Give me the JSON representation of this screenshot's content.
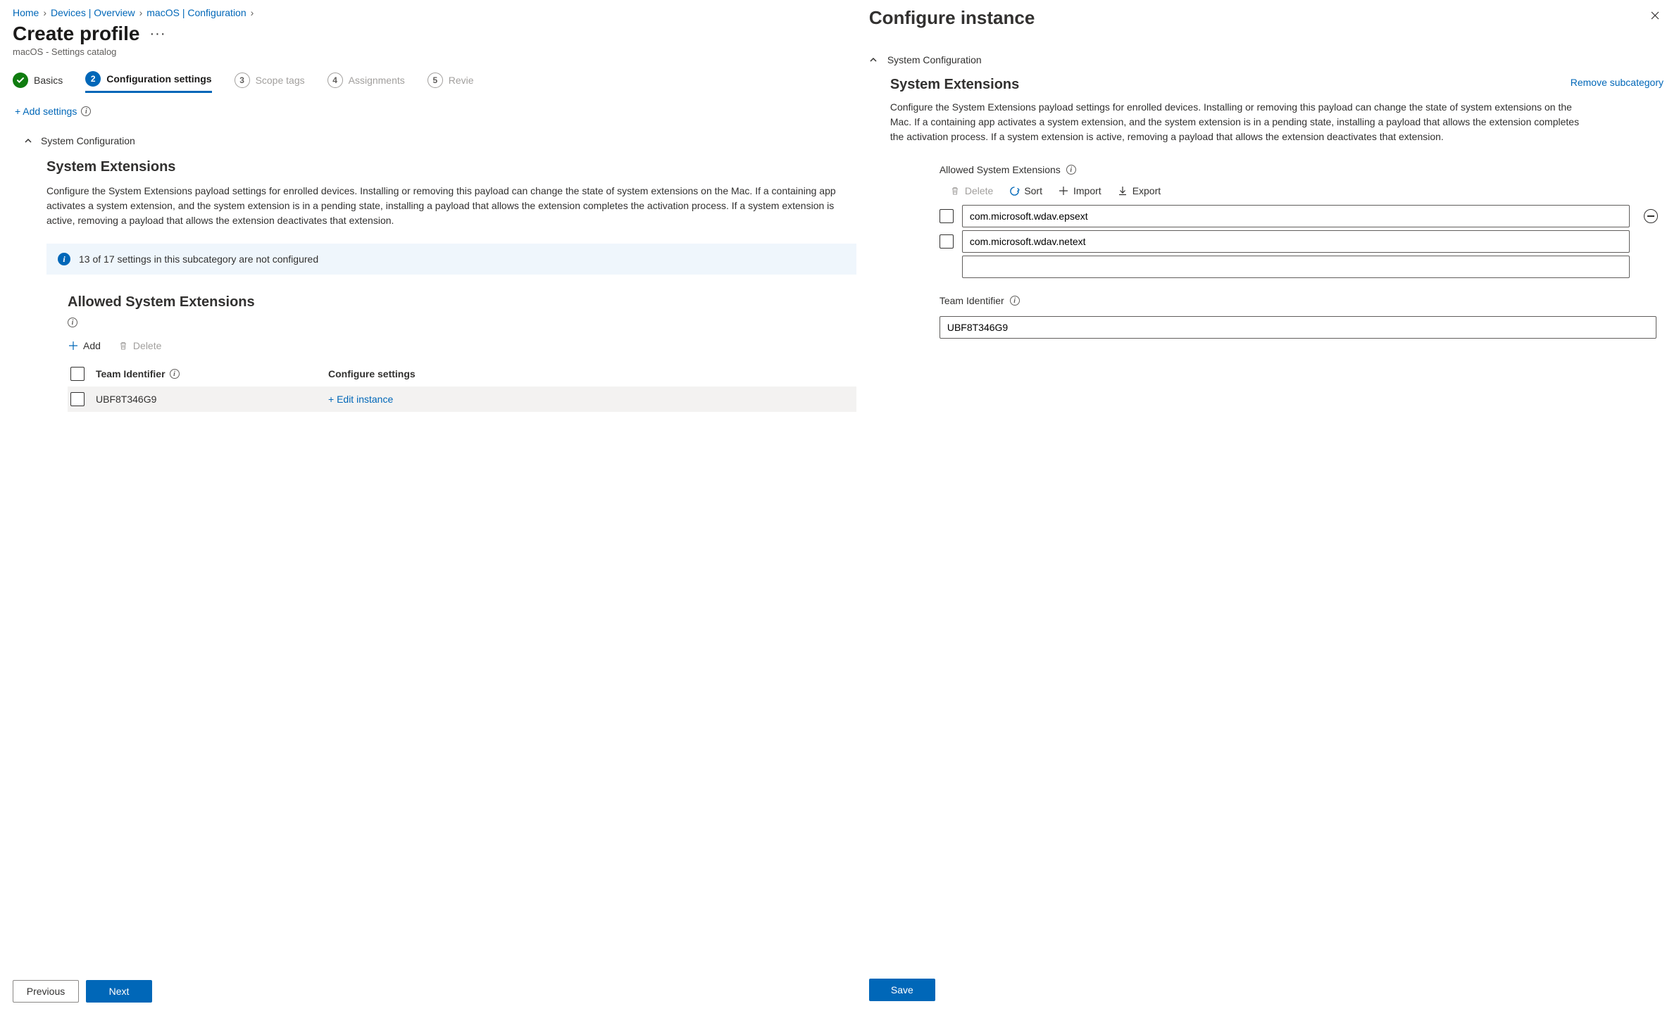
{
  "breadcrumb": {
    "items": [
      "Home",
      "Devices | Overview",
      "macOS | Configuration"
    ]
  },
  "page": {
    "title": "Create profile",
    "subtitle": "macOS - Settings catalog"
  },
  "wizard": {
    "steps": [
      {
        "label": "Basics"
      },
      {
        "label": "Configuration settings",
        "num": "2"
      },
      {
        "label": "Scope tags",
        "num": "3"
      },
      {
        "label": "Assignments",
        "num": "4"
      },
      {
        "label": "Revie",
        "num": "5"
      }
    ]
  },
  "actions": {
    "add_settings": "+ Add settings"
  },
  "section": {
    "name": "System Configuration",
    "sub_title": "System Extensions",
    "desc": "Configure the System Extensions payload settings for enrolled devices. Installing or removing this payload can change the state of system extensions on the Mac. If a containing app activates a system extension, and the system extension is in a pending state, installing a payload that allows the extension completes the activation process. If a system extension is active, removing a payload that allows the extension deactivates that extension.",
    "banner": "13 of 17 settings in this subcategory are not configured",
    "allowed_title": "Allowed System Extensions",
    "toolbar": {
      "add": "Add",
      "delete": "Delete"
    },
    "table": {
      "col_id": "Team Identifier",
      "col_conf": "Configure settings",
      "rows": [
        {
          "id": "UBF8T346G9",
          "action": "+ Edit instance"
        }
      ]
    }
  },
  "footer": {
    "previous": "Previous",
    "next": "Next"
  },
  "panel": {
    "title": "Configure instance",
    "section_name": "System Configuration",
    "sub_title": "System Extensions",
    "remove_link": "Remove subcategory",
    "desc": "Configure the System Extensions payload settings for enrolled devices. Installing or removing this payload can change the state of system extensions on the Mac. If a containing app activates a system extension, and the system extension is in a pending state, installing a payload that allows the extension completes the activation process. If a system extension is active, removing a payload that allows the extension deactivates that extension.",
    "allowed_label": "Allowed System Extensions",
    "list_toolbar": {
      "delete": "Delete",
      "sort": "Sort",
      "import": "Import",
      "export": "Export"
    },
    "list_items": [
      "com.microsoft.wdav.epsext",
      "com.microsoft.wdav.netext",
      ""
    ],
    "team_label": "Team Identifier",
    "team_value": "UBF8T346G9",
    "save": "Save"
  }
}
